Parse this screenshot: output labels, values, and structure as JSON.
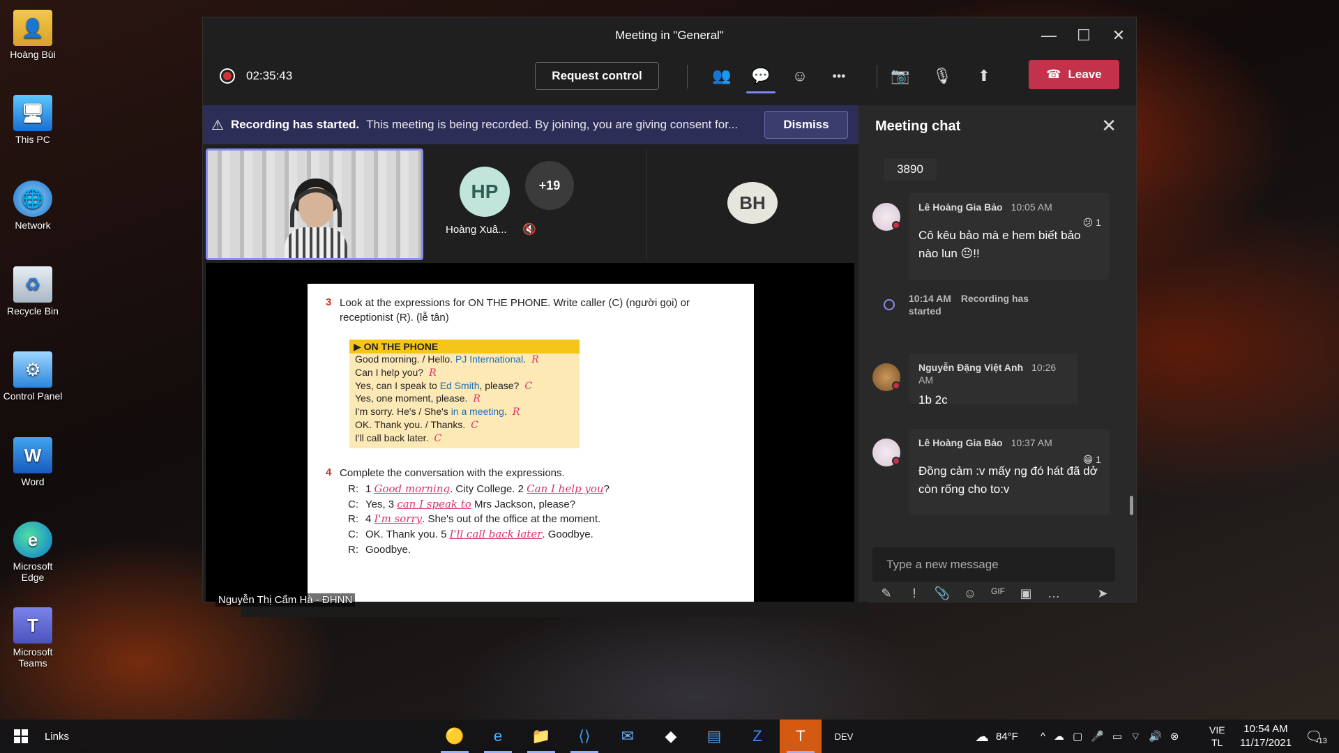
{
  "desktop": {
    "icons": [
      {
        "label": "Hoàng Bùi"
      },
      {
        "label": "This PC"
      },
      {
        "label": "Network"
      },
      {
        "label": "Recycle Bin"
      },
      {
        "label": "Control Panel"
      },
      {
        "label": "Word"
      },
      {
        "label": "Microsoft Edge"
      },
      {
        "label": "Microsoft Teams"
      }
    ]
  },
  "window": {
    "title": "Meeting in \"General\""
  },
  "toolbar": {
    "timer": "02:35:43",
    "request_control": "Request control",
    "more": "•••",
    "leave": "Leave"
  },
  "banner": {
    "heading": "Recording has started.",
    "message": "This meeting is being recorded. By joining, you are giving consent for...",
    "dismiss": "Dismiss"
  },
  "participants": {
    "hp_initials": "HP",
    "hp_name": "Hoàng Xuâ...",
    "overflow": "+19",
    "bh_initials": "BH",
    "presenter": "Nguyễn Thị Cẩm Hà - ĐHNN"
  },
  "document": {
    "q3_num": "3",
    "q3_text_1": "Look at the expressions for ON THE PHONE. Write caller (C) (người gọi) or",
    "q3_text_2": "receptionist (R). (lễ tân)",
    "box_header": "ON THE PHONE",
    "box_lines": [
      {
        "a": "Good morning. / Hello. ",
        "b": "PJ International",
        "c": ".",
        "mark": "R"
      },
      {
        "a": "Can I help you?",
        "b": "",
        "c": "",
        "mark": "R"
      },
      {
        "a": "Yes, can I speak to ",
        "b": "Ed Smith",
        "c": ", please?",
        "mark": "C"
      },
      {
        "a": "Yes, one moment, please.",
        "b": "",
        "c": "",
        "mark": "R"
      },
      {
        "a": "I'm sorry. He's / She's ",
        "b": "in a meeting",
        "c": ".",
        "mark": "R"
      },
      {
        "a": "OK. Thank you. / Thanks.",
        "b": "",
        "c": "",
        "mark": "C"
      },
      {
        "a": "I'll call back later.",
        "b": "",
        "c": "",
        "mark": "C"
      }
    ],
    "q4_num": "4",
    "q4_text": "Complete the conversation with the expressions.",
    "conv": [
      {
        "spk": "R:",
        "pre": "1 ",
        "ans1": "Good morning",
        "mid": ". City College. 2 ",
        "ans2": "Can I help you",
        "post": "?"
      },
      {
        "spk": "C:",
        "pre": "Yes, 3 ",
        "ans1": "can I speak to",
        "mid": " Mrs Jackson, please?",
        "ans2": "",
        "post": ""
      },
      {
        "spk": "R:",
        "pre": "4 ",
        "ans1": "I'm sorry",
        "mid": ". She's out of the office at the moment.",
        "ans2": "",
        "post": ""
      },
      {
        "spk": "C:",
        "pre": "OK. Thank you. 5 ",
        "ans1": "I'll call back later",
        "mid": ". Goodbye.",
        "ans2": "",
        "post": ""
      },
      {
        "spk": "R:",
        "pre": "Goodbye.",
        "ans1": "",
        "mid": "",
        "ans2": "",
        "post": ""
      }
    ]
  },
  "chat": {
    "title": "Meeting chat",
    "first_snippet": "3890",
    "messages": [
      {
        "author": "Lê Hoàng Gia Bảo",
        "time": "10:05 AM",
        "reaction_count": "1",
        "text": "Cô kêu bảo mà e hem biết bảo nào lun 😐!!"
      },
      {
        "author": "Nguyễn Đặng Việt Anh",
        "time": "10:26 AM",
        "text": "1b 2c"
      },
      {
        "author": "Lê Hoàng Gia Bảo",
        "time": "10:37 AM",
        "reaction_count": "1",
        "text": "Đồng cảm :v mấy ng đó hát đã dở còn rống cho to:v"
      }
    ],
    "system": {
      "time": "10:14 AM",
      "text": "Recording has started"
    },
    "compose_placeholder": "Type a new message"
  },
  "taskbar": {
    "links": "Links",
    "weather": "84°F",
    "lang1": "VIE",
    "lang2": "TL",
    "time": "10:54 AM",
    "date": "11/17/2021",
    "notif_count": "13"
  },
  "colors": {
    "leave": "#c4314b",
    "banner": "#2d2e57",
    "accent": "#7f85f5"
  }
}
